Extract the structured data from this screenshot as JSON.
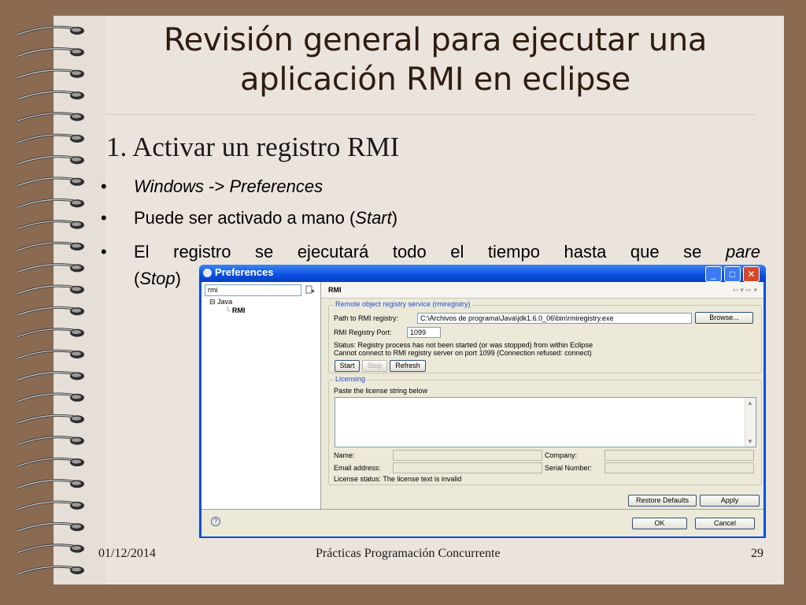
{
  "slide": {
    "title_line1": "Revisión general para ejecutar una",
    "title_line2": "aplicación RMI en eclipse",
    "subtitle": "1. Activar un registro RMI",
    "bullet_glyph": "•",
    "bullets": [
      {
        "parts": [
          "Windows",
          " -> ",
          "Preferences"
        ]
      },
      {
        "parts": [
          "Puede ser activado a mano (",
          "Start",
          ")"
        ]
      },
      {
        "parts": [
          "El registro se ejecutará todo el tiempo hasta que se ",
          "pare",
          "(",
          "Stop",
          ")"
        ]
      }
    ],
    "footer": {
      "date": "01/12/2014",
      "center": "Prácticas Programación Concurrente",
      "page": "29"
    }
  },
  "dialog": {
    "title": "Preferences",
    "window_buttons": {
      "minimize": "_",
      "maximize": "□",
      "close": "✕"
    },
    "filter_value": "rmi",
    "tree": {
      "expander": "⊟",
      "parent": "Java",
      "child": "RMI"
    },
    "page_title": "RMI",
    "nav_arrows": "⇦ ▾ ⇨ ▾",
    "registry_group": {
      "title": "Remote object registry service (rmiregistry)",
      "path_label": "Path to RMI registry:",
      "path_value": "C:\\Archivos de programa\\Java\\jdk1.6.0_06\\bin\\rmiregistry.exe",
      "browse": "Browse...",
      "port_label": "RMI Registry Port:",
      "port_value": "1099",
      "status_line1": "Status: Registry process has not been started (or was stopped) from within Eclipse",
      "status_line2": "Cannot connect to RMI registry server on port 1099 (Connection refused: connect)",
      "start": "Start",
      "stop": "Stop",
      "refresh": "Refresh"
    },
    "licensing_group": {
      "title": "Licensing",
      "paste_label": "Paste the license string below",
      "name_label": "Name:",
      "company_label": "Company:",
      "email_label": "Email address:",
      "serial_label": "Serial Number:",
      "status": "License status: The license text is invalid"
    },
    "restore_defaults": "Restore Defaults",
    "apply": "Apply",
    "help": "?",
    "ok": "OK",
    "cancel": "Cancel"
  },
  "colors": {
    "binder": "#8b6a52",
    "paper": "#ebe4dc",
    "title_text": "#2d1c10",
    "dialog_frame": "#0a4ee0",
    "dialog_body": "#ece9d8",
    "group_title": "#2050d0"
  }
}
